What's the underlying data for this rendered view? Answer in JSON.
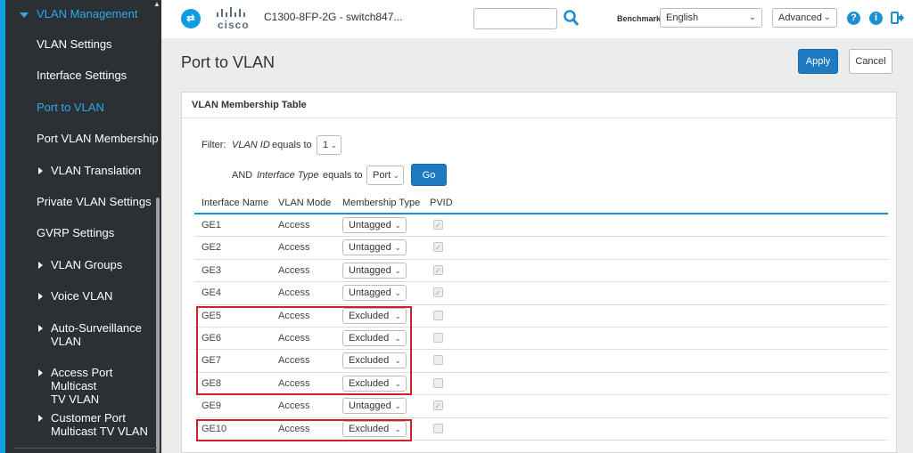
{
  "sidebar": {
    "section_title": "VLAN Management",
    "items": [
      {
        "label": "VLAN Settings",
        "expandable": false,
        "active": false
      },
      {
        "label": "Interface Settings",
        "expandable": false,
        "active": false
      },
      {
        "label": "Port to VLAN",
        "expandable": false,
        "active": true
      },
      {
        "label": "Port VLAN Membership",
        "expandable": false,
        "active": false
      },
      {
        "label": "VLAN Translation",
        "expandable": true,
        "active": false
      },
      {
        "label": "Private VLAN Settings",
        "expandable": false,
        "active": false
      },
      {
        "label": "GVRP Settings",
        "expandable": false,
        "active": false
      },
      {
        "label": "VLAN Groups",
        "expandable": true,
        "active": false
      },
      {
        "label": "Voice VLAN",
        "expandable": true,
        "active": false
      },
      {
        "label": "Auto-Surveillance\nVLAN",
        "expandable": true,
        "active": false
      },
      {
        "label": "Access Port Multicast\nTV VLAN",
        "expandable": true,
        "active": false
      },
      {
        "label": "Customer Port\nMulticast TV VLAN",
        "expandable": true,
        "active": false
      }
    ]
  },
  "header": {
    "logo_text": "cisco",
    "device_name": "C1300-8FP-2G - switch847...",
    "search_value": "",
    "benchmark_label": "Benchmark",
    "language": "English",
    "mode": "Advanced",
    "icons": [
      "help-icon",
      "info-icon",
      "logout-icon",
      "search-icon"
    ]
  },
  "page": {
    "title": "Port to VLAN",
    "apply_label": "Apply",
    "cancel_label": "Cancel"
  },
  "panel": {
    "title": "VLAN Membership Table",
    "filter_label": "Filter:",
    "filter_field": "VLAN ID",
    "equals_to": "equals to",
    "vlan_id_value": "1",
    "and_label": "AND",
    "interface_type_field": "Interface Type",
    "interface_type_value": "Port",
    "go_label": "Go"
  },
  "table": {
    "columns": [
      "Interface Name",
      "VLAN Mode",
      "Membership Type",
      "PVID"
    ],
    "rows": [
      {
        "name": "GE1",
        "mode": "Access",
        "membership": "Untagged",
        "pvid": true
      },
      {
        "name": "GE2",
        "mode": "Access",
        "membership": "Untagged",
        "pvid": true
      },
      {
        "name": "GE3",
        "mode": "Access",
        "membership": "Untagged",
        "pvid": true
      },
      {
        "name": "GE4",
        "mode": "Access",
        "membership": "Untagged",
        "pvid": true
      },
      {
        "name": "GE5",
        "mode": "Access",
        "membership": "Excluded",
        "pvid": false
      },
      {
        "name": "GE6",
        "mode": "Access",
        "membership": "Excluded",
        "pvid": false
      },
      {
        "name": "GE7",
        "mode": "Access",
        "membership": "Excluded",
        "pvid": false
      },
      {
        "name": "GE8",
        "mode": "Access",
        "membership": "Excluded",
        "pvid": false
      },
      {
        "name": "GE9",
        "mode": "Access",
        "membership": "Untagged",
        "pvid": true
      },
      {
        "name": "GE10",
        "mode": "Access",
        "membership": "Excluded",
        "pvid": false
      }
    ]
  },
  "colors": {
    "accent": "#1f8fd4",
    "sidebar_bg": "#2b3035",
    "active_nav": "#2fa8e8",
    "highlight": "#d0202a"
  }
}
